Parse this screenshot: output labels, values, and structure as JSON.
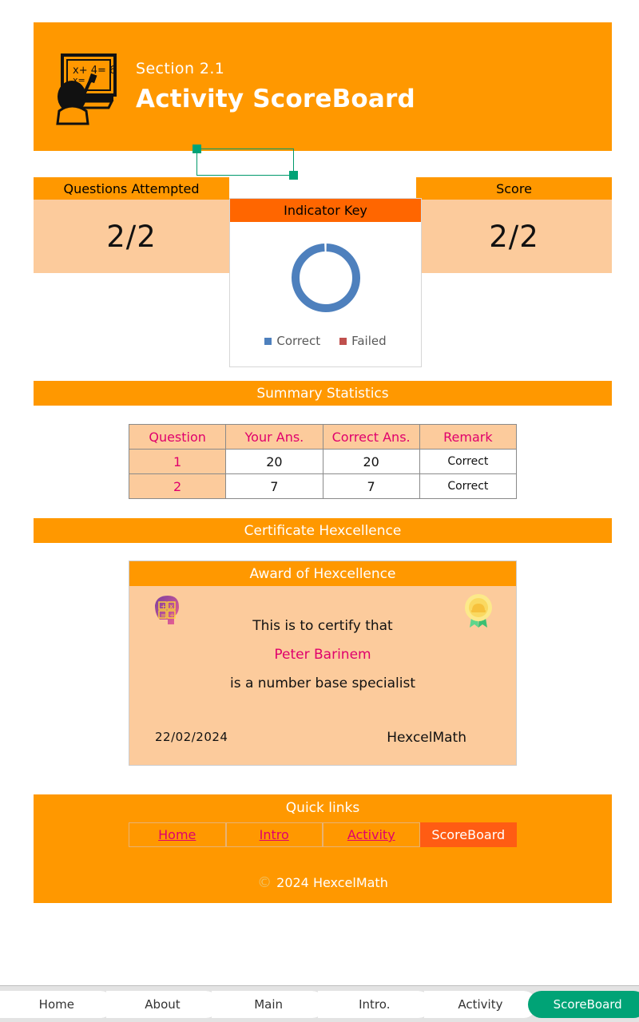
{
  "header": {
    "section_label": "Section 2.1",
    "title": "Activity ScoreBoard",
    "icon": "teacher-blackboard-icon",
    "background_color": "#FF9800"
  },
  "stats": {
    "questions_attempted": {
      "label": "Questions Attempted",
      "value": "2/2"
    },
    "score": {
      "label": "Score",
      "value": "2/2"
    }
  },
  "indicator_key": {
    "title": "Indicator Key",
    "legend": [
      {
        "label": "Correct",
        "color": "#4E80BD"
      },
      {
        "label": "Failed",
        "color": "#C0504D"
      }
    ]
  },
  "chart_data": {
    "type": "pie",
    "title": "Indicator Key",
    "categories": [
      "Correct",
      "Failed"
    ],
    "values": [
      2,
      0
    ],
    "colors": [
      "#4E80BD",
      "#C0504D"
    ],
    "donut": true,
    "legend_position": "bottom"
  },
  "summary": {
    "section_title": "Summary Statistics",
    "columns": [
      "Question",
      "Your Ans.",
      "Correct Ans.",
      "Remark"
    ],
    "rows": [
      {
        "question": "1",
        "your_ans": "20",
        "correct_ans": "20",
        "remark": "Correct"
      },
      {
        "question": "2",
        "your_ans": "7",
        "correct_ans": "7",
        "remark": "Correct"
      }
    ]
  },
  "certificate": {
    "section_title": "Certificate Hexcellence",
    "card_title": "Award of Hexcellence",
    "line1": "This is to certify that",
    "name": "Peter Barinem",
    "line2": "is a number base specialist",
    "date": "22/02/2024",
    "organization": "HexcelMath",
    "icon_left": "math-head-icon",
    "icon_right": "award-medal-icon"
  },
  "quick_links": {
    "title": "Quick links",
    "items": [
      {
        "label": "Home",
        "active": false
      },
      {
        "label": "Intro",
        "active": false
      },
      {
        "label": "Activity",
        "active": false
      },
      {
        "label": "ScoreBoard",
        "active": true
      }
    ],
    "copyright": "2024 HexcelMath",
    "copyright_symbol": "©"
  },
  "bottom_nav": {
    "items": [
      {
        "label": "Home",
        "active": false
      },
      {
        "label": "About",
        "active": false
      },
      {
        "label": "Main",
        "active": false
      },
      {
        "label": "Intro.",
        "active": false
      },
      {
        "label": "Activity",
        "active": false
      },
      {
        "label": "ScoreBoard",
        "active": true
      }
    ],
    "active_color": "#00A376"
  }
}
